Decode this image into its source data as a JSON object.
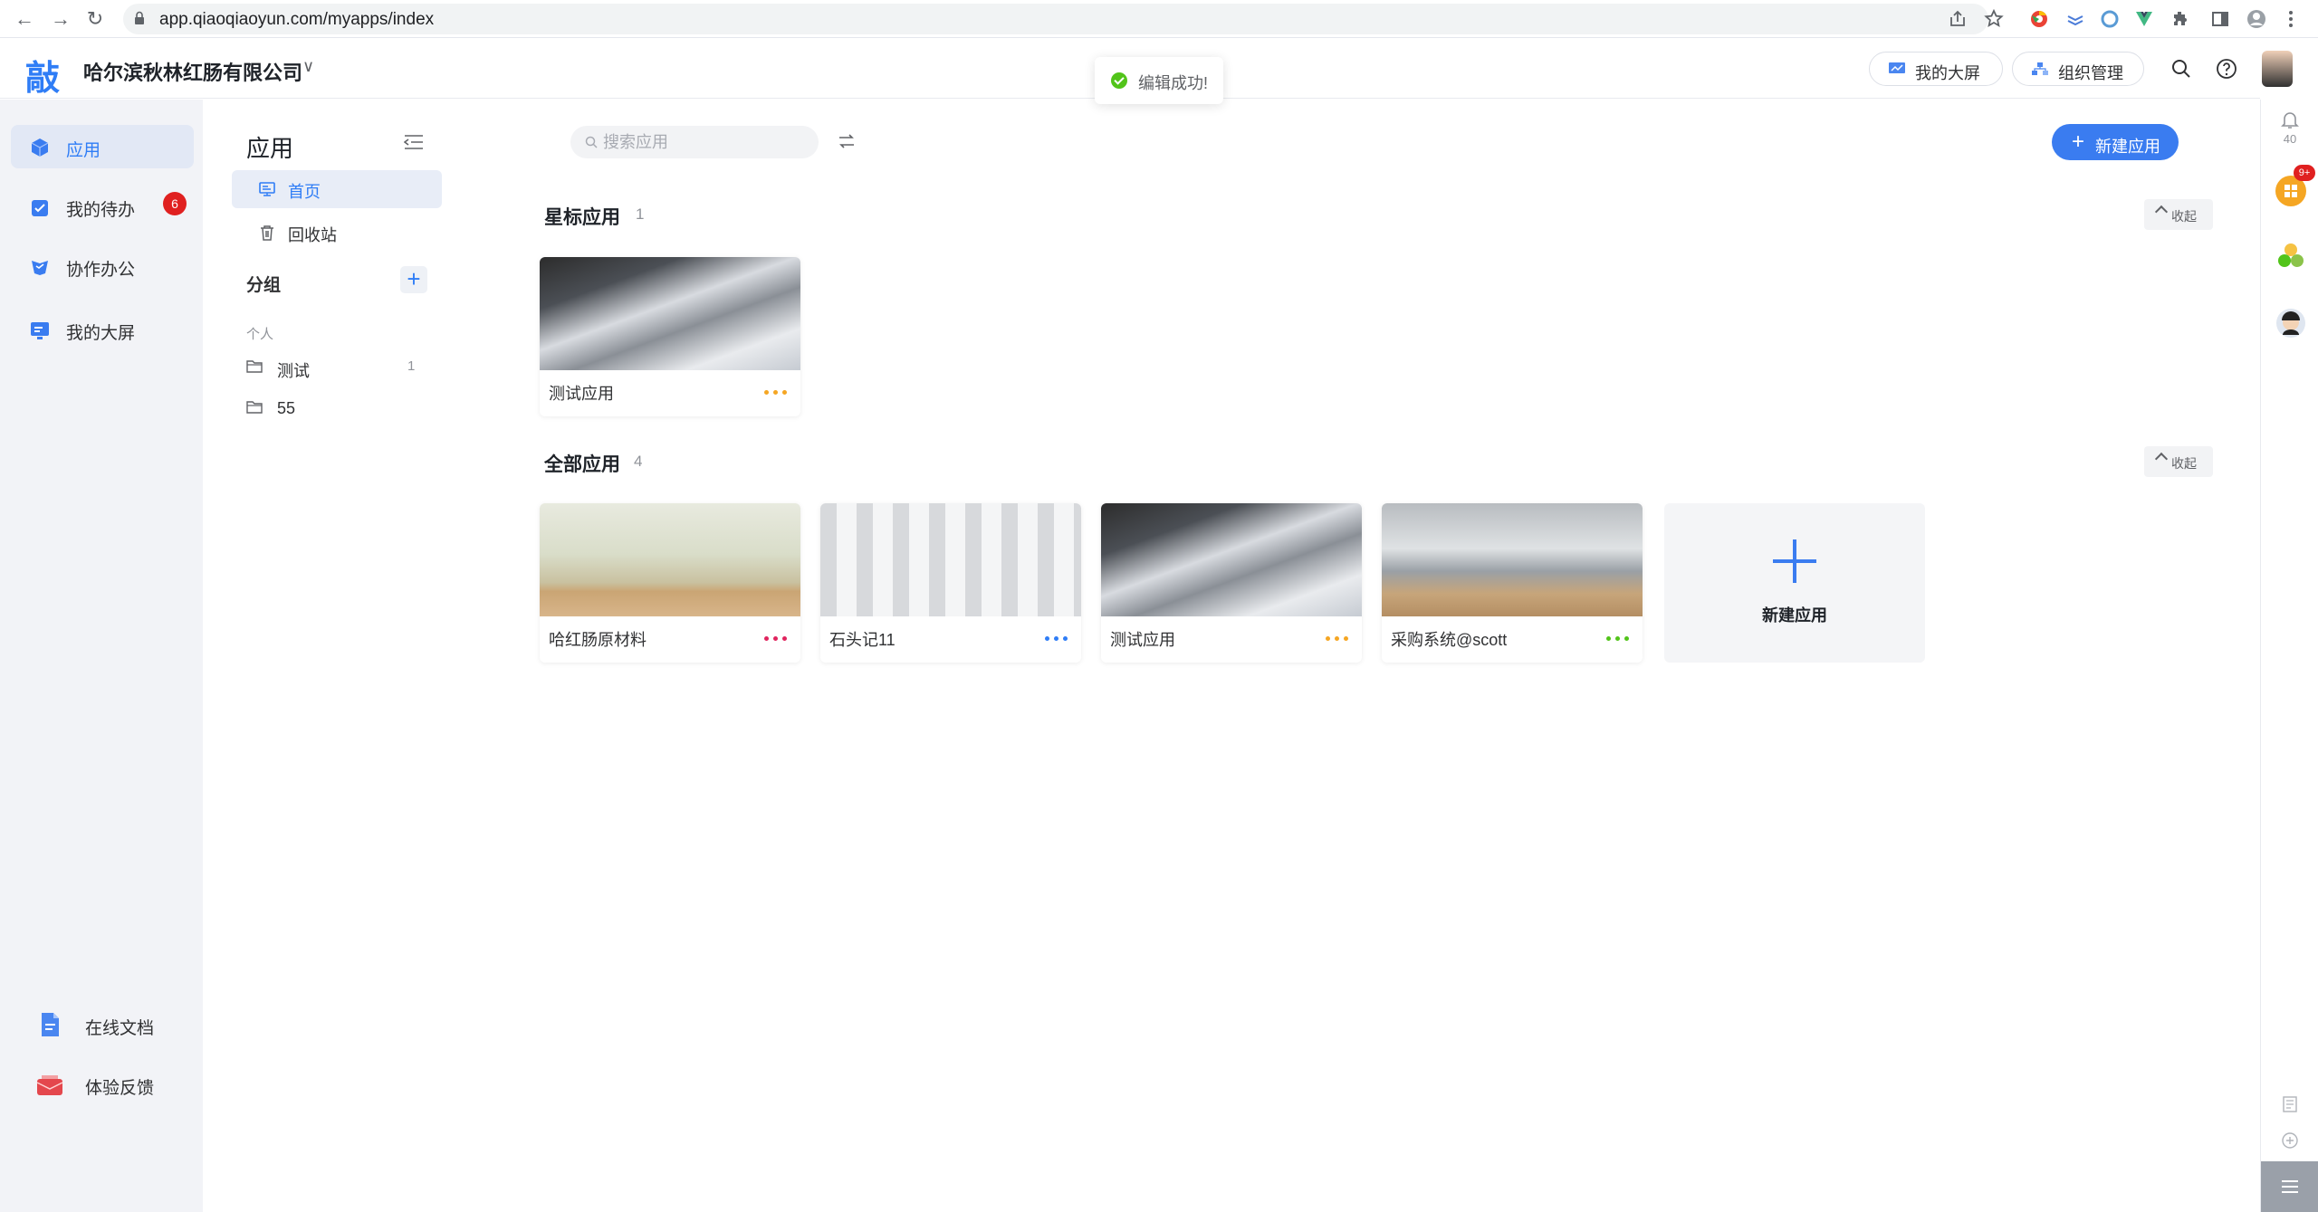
{
  "browser": {
    "url": "app.qiaoqiaoyun.com/myapps/index"
  },
  "header": {
    "logo_text": "敲",
    "company": "哈尔滨秋林红肠有限公司",
    "toast": "编辑成功!",
    "my_screen": "我的大屏",
    "org_manage": "组织管理"
  },
  "left_nav": {
    "items": [
      {
        "label": "应用",
        "icon": "cube-icon"
      },
      {
        "label": "我的待办",
        "icon": "todo-icon",
        "badge": "6"
      },
      {
        "label": "协作办公",
        "icon": "collab-icon"
      },
      {
        "label": "我的大屏",
        "icon": "screen-icon"
      }
    ],
    "bottom": [
      {
        "label": "在线文档",
        "icon": "document-icon"
      },
      {
        "label": "体验反馈",
        "icon": "feedback-icon"
      }
    ]
  },
  "panel": {
    "title": "应用",
    "home": "首页",
    "recycle": "回收站",
    "group_title": "分组",
    "personal": "个人",
    "folders": [
      {
        "label": "测试",
        "count": "1"
      },
      {
        "label": "55",
        "count": ""
      }
    ]
  },
  "main": {
    "search_placeholder": "搜索应用",
    "new_app": "新建应用",
    "starred": {
      "title": "星标应用",
      "count": "1",
      "collapse": "收起"
    },
    "all": {
      "title": "全部应用",
      "count": "4",
      "collapse": "收起"
    },
    "starred_apps": [
      {
        "name": "测试应用",
        "dots_color": "#f5a623",
        "image": "business-meeting"
      }
    ],
    "all_apps": [
      {
        "name": "哈红肠原材料",
        "dots_color": "#e0245e",
        "image": "wood-table"
      },
      {
        "name": "石头记11",
        "dots_color": "#2f7df6",
        "image": "white-hall"
      },
      {
        "name": "测试应用",
        "dots_color": "#f5a623",
        "image": "business-meeting"
      },
      {
        "name": "采购系统@scott",
        "dots_color": "#52c41a",
        "image": "office-room"
      }
    ],
    "new_card_label": "新建应用"
  },
  "right_rail": {
    "notifications": "40",
    "apps_badge": "9+"
  },
  "colors": {
    "accent": "#2f7df6",
    "badge": "#e02020",
    "success": "#52c41a"
  }
}
